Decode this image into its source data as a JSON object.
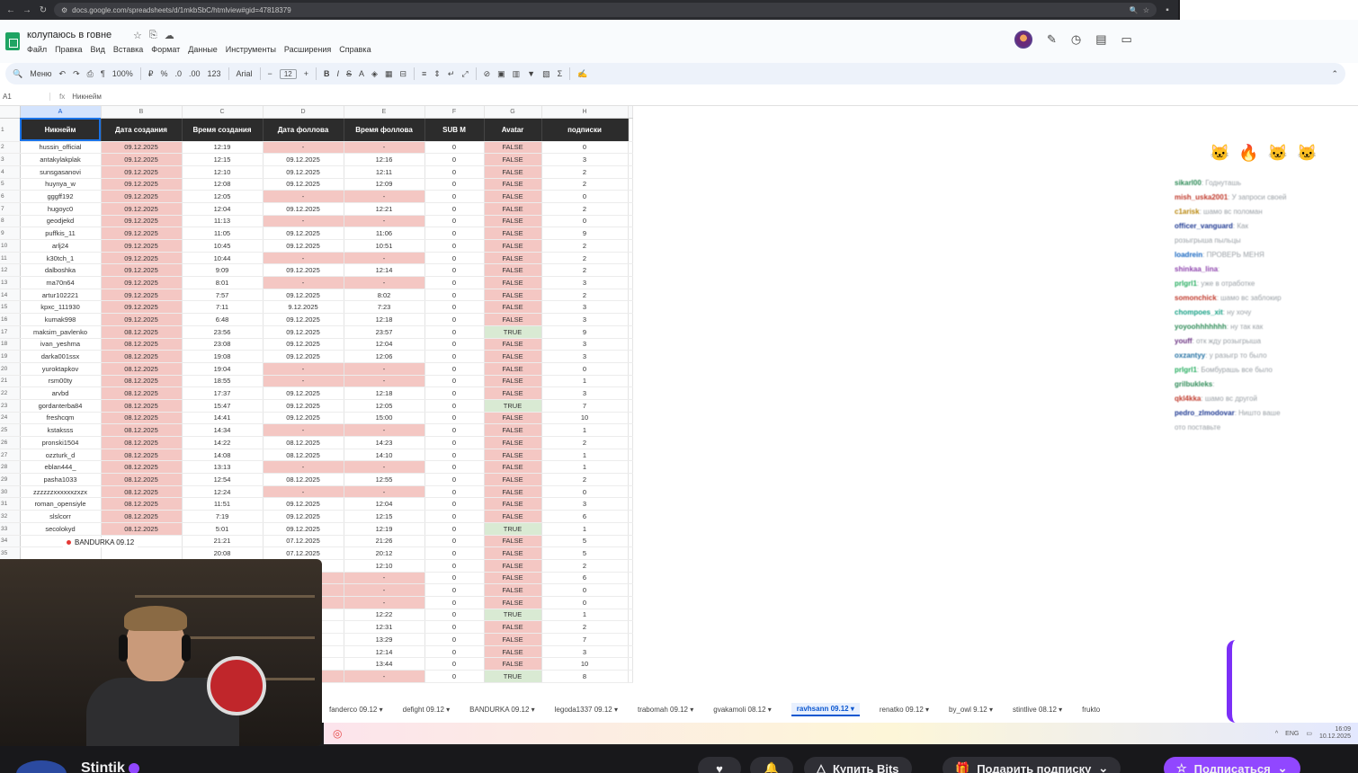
{
  "browser": {
    "url": "docs.google.com/spreadsheets/d/1mkbSbC/htmlview#gid=47818379"
  },
  "doc": {
    "title": "колупаюсь в говне"
  },
  "menu": [
    "Файл",
    "Правка",
    "Вид",
    "Вставка",
    "Формат",
    "Данные",
    "Инструменты",
    "Расширения",
    "Справка"
  ],
  "toolbar": {
    "search": "Меню",
    "zoom": "100%",
    "font": "Arial",
    "font_size": "12",
    "number_fmt": "123"
  },
  "formula": {
    "cell": "A1",
    "content": "Никнейм"
  },
  "columns": [
    "A",
    "B",
    "C",
    "D",
    "E",
    "F",
    "G",
    "H"
  ],
  "headers": [
    "Никнейм",
    "Дата создания",
    "Время создания",
    "Дата фоллова",
    "Время фоллова",
    "SUB M",
    "Avatar",
    "подписки"
  ],
  "rows": [
    [
      "hussin_official",
      "09.12.2025",
      "12:19",
      "-",
      "-",
      "0",
      "FALSE",
      "0"
    ],
    [
      "antakylakplak",
      "09.12.2025",
      "12:15",
      "09.12.2025",
      "12:16",
      "0",
      "FALSE",
      "3"
    ],
    [
      "sunsgasanovi",
      "09.12.2025",
      "12:10",
      "09.12.2025",
      "12:11",
      "0",
      "FALSE",
      "2"
    ],
    [
      "huynya_w",
      "09.12.2025",
      "12:08",
      "09.12.2025",
      "12:09",
      "0",
      "FALSE",
      "2"
    ],
    [
      "gggff192",
      "09.12.2025",
      "12:05",
      "-",
      "-",
      "0",
      "FALSE",
      "0"
    ],
    [
      "hugoyc0",
      "09.12.2025",
      "12:04",
      "09.12.2025",
      "12:21",
      "0",
      "FALSE",
      "2"
    ],
    [
      "geodjekd",
      "09.12.2025",
      "11:13",
      "-",
      "-",
      "0",
      "FALSE",
      "0"
    ],
    [
      "puffkis_11",
      "09.12.2025",
      "11:05",
      "09.12.2025",
      "11:06",
      "0",
      "FALSE",
      "9"
    ],
    [
      "arlj24",
      "09.12.2025",
      "10:45",
      "09.12.2025",
      "10:51",
      "0",
      "FALSE",
      "2"
    ],
    [
      "k30tch_1",
      "09.12.2025",
      "10:44",
      "-",
      "-",
      "0",
      "FALSE",
      "2"
    ],
    [
      "dalboshka",
      "09.12.2025",
      "9:09",
      "09.12.2025",
      "12:14",
      "0",
      "FALSE",
      "2"
    ],
    [
      "ma70n64",
      "09.12.2025",
      "8:01",
      "-",
      "-",
      "0",
      "FALSE",
      "3"
    ],
    [
      "artur102221",
      "09.12.2025",
      "7:57",
      "09.12.2025",
      "8:02",
      "0",
      "FALSE",
      "2"
    ],
    [
      "kpxc_111930",
      "09.12.2025",
      "7:11",
      "9.12.2025",
      "7:23",
      "0",
      "FALSE",
      "3"
    ],
    [
      "kumak998",
      "09.12.2025",
      "6:48",
      "09.12.2025",
      "12:18",
      "0",
      "FALSE",
      "3"
    ],
    [
      "maksim_pavlenko",
      "08.12.2025",
      "23:56",
      "09.12.2025",
      "23:57",
      "0",
      "TRUE",
      "9"
    ],
    [
      "ivan_yeshma",
      "08.12.2025",
      "23:08",
      "09.12.2025",
      "12:04",
      "0",
      "FALSE",
      "3"
    ],
    [
      "darka001ssx",
      "08.12.2025",
      "19:08",
      "09.12.2025",
      "12:06",
      "0",
      "FALSE",
      "3"
    ],
    [
      "yuroktapkov",
      "08.12.2025",
      "19:04",
      "-",
      "-",
      "0",
      "FALSE",
      "0"
    ],
    [
      "rsm00ty",
      "08.12.2025",
      "18:55",
      "-",
      "-",
      "0",
      "FALSE",
      "1"
    ],
    [
      "arvbd",
      "08.12.2025",
      "17:37",
      "09.12.2025",
      "12:18",
      "0",
      "FALSE",
      "3"
    ],
    [
      "gordanterba84",
      "08.12.2025",
      "15:47",
      "09.12.2025",
      "12:05",
      "0",
      "TRUE",
      "7"
    ],
    [
      "freshcqm",
      "08.12.2025",
      "14:41",
      "09.12.2025",
      "15:00",
      "0",
      "FALSE",
      "10"
    ],
    [
      "kstaksss",
      "08.12.2025",
      "14:34",
      "-",
      "-",
      "0",
      "FALSE",
      "1"
    ],
    [
      "pronski1504",
      "08.12.2025",
      "14:22",
      "08.12.2025",
      "14:23",
      "0",
      "FALSE",
      "2"
    ],
    [
      "ozzturk_d",
      "08.12.2025",
      "14:08",
      "08.12.2025",
      "14:10",
      "0",
      "FALSE",
      "1"
    ],
    [
      "eblan444_",
      "08.12.2025",
      "13:13",
      "-",
      "-",
      "0",
      "FALSE",
      "1"
    ],
    [
      "pasha1033",
      "08.12.2025",
      "12:54",
      "08.12.2025",
      "12:55",
      "0",
      "FALSE",
      "2"
    ],
    [
      "zzzzzzxxxxxxzxzx",
      "08.12.2025",
      "12:24",
      "-",
      "-",
      "0",
      "FALSE",
      "0"
    ],
    [
      "roman_opensiyle",
      "08.12.2025",
      "11:51",
      "09.12.2025",
      "12:04",
      "0",
      "FALSE",
      "3"
    ],
    [
      "slslcorr",
      "08.12.2025",
      "7:19",
      "09.12.2025",
      "12:15",
      "0",
      "FALSE",
      "6"
    ],
    [
      "secolokyd",
      "08.12.2025",
      "5:01",
      "09.12.2025",
      "12:19",
      "0",
      "TRUE",
      "1"
    ],
    [
      "",
      "",
      "21:21",
      "07.12.2025",
      "21:26",
      "0",
      "FALSE",
      "5"
    ],
    [
      "",
      "",
      "20:08",
      "07.12.2025",
      "20:12",
      "0",
      "FALSE",
      "5"
    ],
    [
      "",
      "",
      "",
      "",
      "12:10",
      "0",
      "FALSE",
      "2"
    ],
    [
      "",
      "",
      "",
      "-",
      "-",
      "0",
      "FALSE",
      "6"
    ],
    [
      "",
      "",
      "",
      "-",
      "-",
      "0",
      "FALSE",
      "0"
    ],
    [
      "",
      "",
      "",
      "-",
      "-",
      "0",
      "FALSE",
      "0"
    ],
    [
      "",
      "",
      "",
      "",
      "12:22",
      "0",
      "TRUE",
      "1"
    ],
    [
      "",
      "",
      "",
      "",
      "12:31",
      "0",
      "FALSE",
      "2"
    ],
    [
      "",
      "",
      "",
      "",
      "13:29",
      "0",
      "FALSE",
      "7"
    ],
    [
      "",
      "",
      "",
      "",
      "12:14",
      "0",
      "FALSE",
      "3"
    ],
    [
      "",
      "",
      "",
      "",
      "13:44",
      "0",
      "FALSE",
      "10"
    ],
    [
      "",
      "",
      "",
      "-",
      "-",
      "0",
      "TRUE",
      "8"
    ]
  ],
  "webcam": {
    "label": "BANDURKA 09.12"
  },
  "sheet_tabs": [
    "fanderco 09.12",
    "defight 09.12",
    "BANDURKA 09.12",
    "legoda1337 09.12",
    "trabomah 09.12",
    "gvakamoli 08.12",
    "ravhsann 09.12",
    "renatko 09.12",
    "by_owl 9.12",
    "stintlive 08.12",
    "frukto"
  ],
  "active_tab": "ravhsann 09.12",
  "chat": [
    {
      "user": "sikarl00",
      "color": "#2e8b57",
      "msg": "Годнуташь"
    },
    {
      "user": "mish_uska2001",
      "color": "#c0392b",
      "msg": "У запроси своей"
    },
    {
      "user": "c1arisk",
      "color": "#b8860b",
      "msg": "шамо вс поломан"
    },
    {
      "user": "officer_vanguard",
      "color": "#1f3a93",
      "msg": "Как"
    },
    {
      "user": "",
      "color": "#999",
      "msg": "розыгрыша пыльцы"
    },
    {
      "user": "loadrein",
      "color": "#1565c0",
      "msg": "ПРОВЕРЬ МЕНЯ"
    },
    {
      "user": "shinkaa_lina",
      "color": "#8e44ad",
      "msg": ""
    },
    {
      "user": "prlgrl1",
      "color": "#27ae60",
      "msg": "уже в отработке"
    },
    {
      "user": "somonchick",
      "color": "#c0392b",
      "msg": "шамо вс заблокир"
    },
    {
      "user": "chompoes_xit",
      "color": "#16a085",
      "msg": "ну хочу"
    },
    {
      "user": "yoyoohhhhhhh",
      "color": "#2e8b57",
      "msg": "ну так как"
    },
    {
      "user": "youff",
      "color": "#6c3483",
      "msg": "отк жду розыгрыша"
    },
    {
      "user": "oxzantyy",
      "color": "#2471a3",
      "msg": "у разыгр то было"
    },
    {
      "user": "prlgrl1",
      "color": "#27ae60",
      "msg": "Бомбурашь все было"
    },
    {
      "user": "grilbukleks",
      "color": "#2e8b57",
      "msg": ""
    },
    {
      "user": "qkl4kka",
      "color": "#c0392b",
      "msg": "шамо вс другой"
    },
    {
      "user": "pedro_zlmodovar",
      "color": "#1f3a93",
      "msg": "Ништо ваше"
    },
    {
      "user": "",
      "color": "#999",
      "msg": "ото поставьте"
    }
  ],
  "taskbar": {
    "lang": "ENG",
    "time": "16:09",
    "date": "10.12.2025"
  },
  "channel": {
    "name": "Stintik"
  },
  "buttons": {
    "bits": "Купить Bits",
    "gift": "Подарить подписку",
    "subscribe": "Подписаться"
  },
  "colors": {
    "missing": "#f4c7c3",
    "true_cell": "#d9ead3",
    "header_bg": "#2c2c2c",
    "accent": "#0b57d0",
    "twitch_purple": "#9147ff"
  }
}
